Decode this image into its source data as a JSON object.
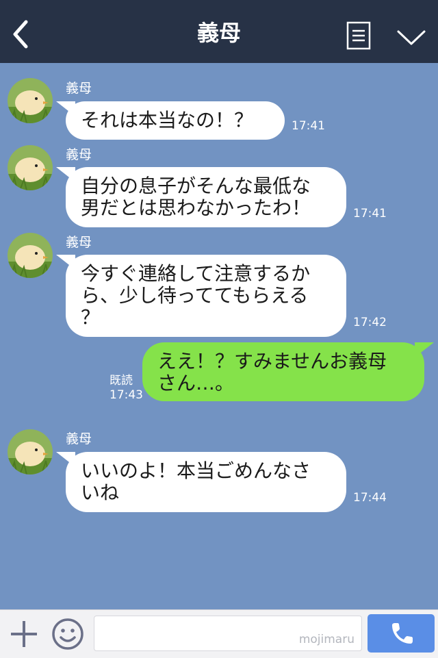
{
  "header": {
    "title": "義母",
    "background": "#273246"
  },
  "chat": {
    "background": "#7293c2",
    "messages": [
      {
        "from": "other",
        "sender": "義母",
        "lines": [
          "それは本当なの！？"
        ],
        "time": "17:41"
      },
      {
        "from": "other",
        "sender": "義母",
        "lines": [
          "自分の息子がそんな最低な",
          "男だとは思わなかったわ！"
        ],
        "time": "17:41"
      },
      {
        "from": "other",
        "sender": "義母",
        "lines": [
          "今すぐ連絡して注意するか",
          "ら、少し待っててもらえる",
          "？"
        ],
        "time": "17:42"
      },
      {
        "from": "me",
        "read": "既読",
        "lines": [
          "ええ！？すみませんお義母",
          "さん…。"
        ],
        "time": "17:43"
      },
      {
        "from": "other",
        "sender": "義母",
        "lines": [
          "いいのよ！本当ごめんなさ",
          "いね"
        ],
        "time": "17:44"
      }
    ]
  },
  "bottom_bar": {
    "input_value": "",
    "watermark": "mojimaru",
    "call_color": "#5a8ee6",
    "my_bubble_color": "#85e24a"
  },
  "icons": [
    "back-icon",
    "menu-icon",
    "chevron-down-icon",
    "plus-icon",
    "emoji-icon",
    "phone-icon",
    "chick-avatar"
  ]
}
